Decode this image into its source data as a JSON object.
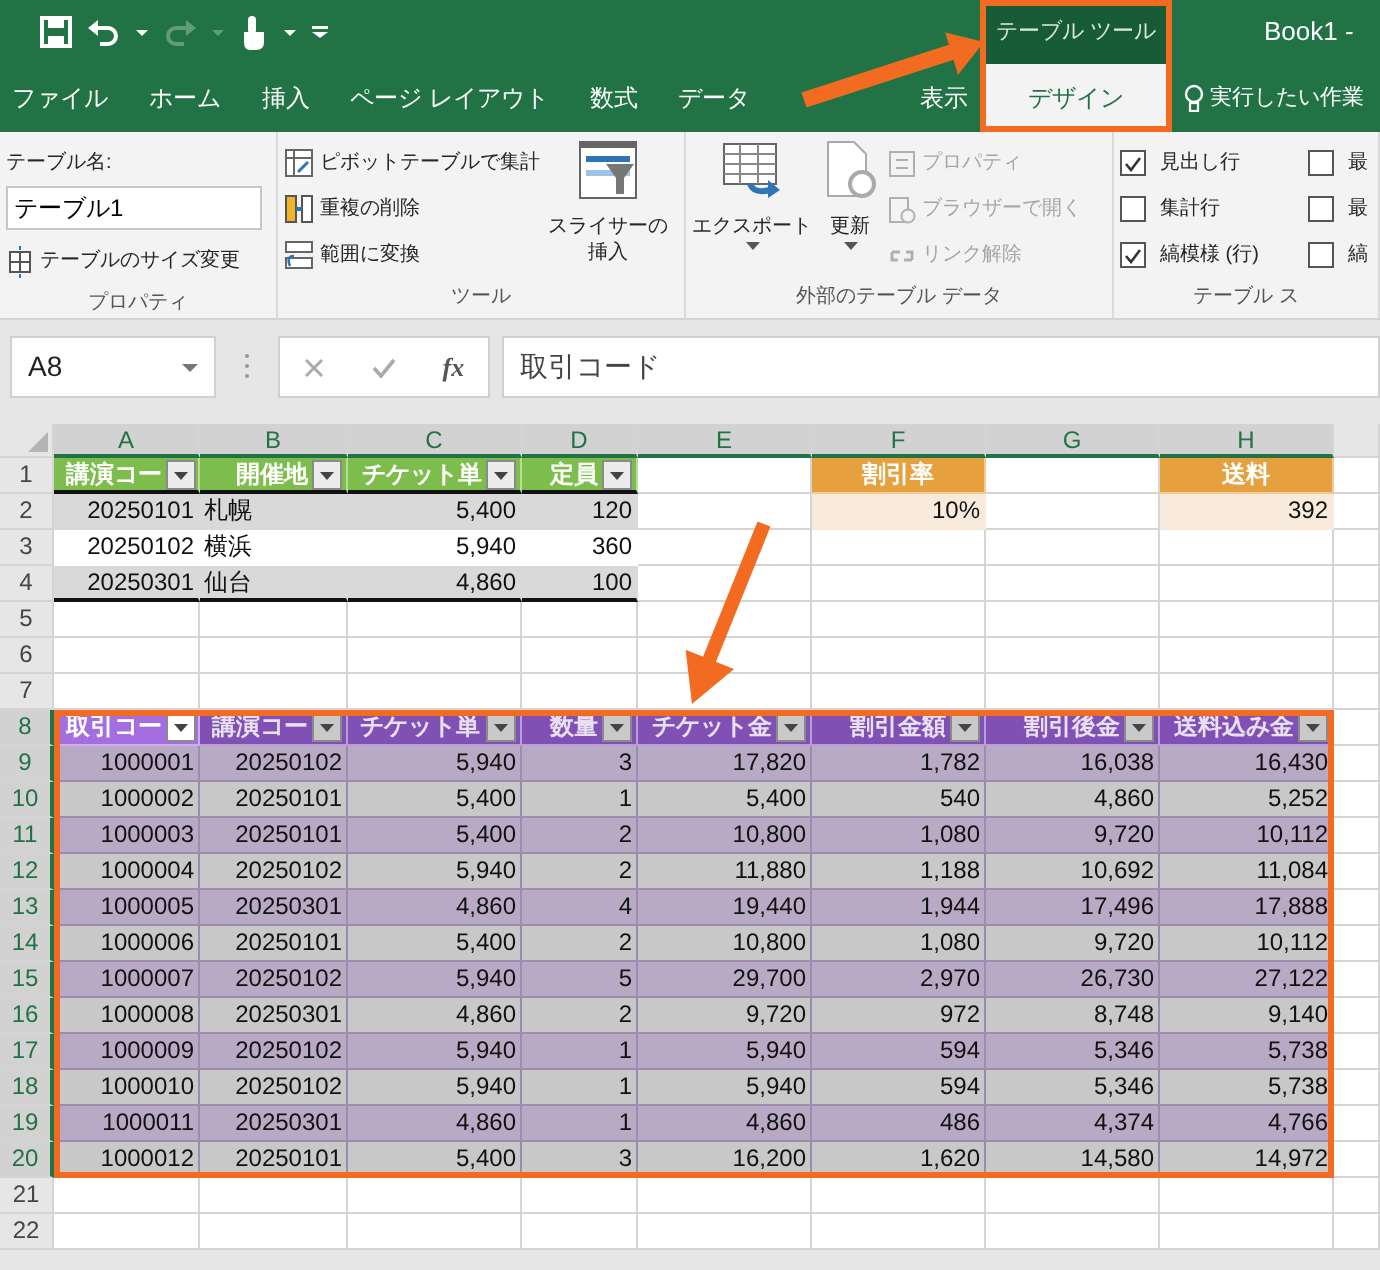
{
  "title_bar": {
    "context_tab": "テーブル ツール",
    "title": "Book1 -"
  },
  "tabs": [
    {
      "label": "ファイル",
      "selected": false
    },
    {
      "label": "ホーム",
      "selected": false
    },
    {
      "label": "挿入",
      "selected": false
    },
    {
      "label": "ページ レイアウト",
      "selected": false
    },
    {
      "label": "数式",
      "selected": false
    },
    {
      "label": "データ",
      "selected": false
    },
    {
      "label": "表示",
      "selected": false
    },
    {
      "label": "デザイン",
      "selected": true
    }
  ],
  "tell_me": "実行したい作業",
  "ribbon": {
    "groups": [
      {
        "kind": "properties",
        "label": "プロパティ",
        "name_label": "テーブル名:",
        "name_value": "テーブル1",
        "resize": "テーブルのサイズ変更"
      },
      {
        "kind": "tools",
        "label": "ツール",
        "buttons": [
          "ピボットテーブルで集計",
          "重複の削除",
          "範囲に変換"
        ],
        "slicer": [
          "スライサーの",
          "挿入"
        ]
      },
      {
        "kind": "external",
        "label": "外部のテーブル データ",
        "large": [
          "エクスポート",
          "更新"
        ],
        "buttons": [
          {
            "label": "プロパティ",
            "disabled": true
          },
          {
            "label": "ブラウザーで開く",
            "disabled": true
          },
          {
            "label": "リンク解除",
            "disabled": true
          }
        ]
      },
      {
        "kind": "style_options",
        "label": "テーブル ス",
        "options": [
          {
            "label": "見出し行",
            "checked": true
          },
          {
            "label": "最",
            "checked": false
          },
          {
            "label": "集計行",
            "checked": false
          },
          {
            "label": "最",
            "checked": false
          },
          {
            "label": "縞模様 (行)",
            "checked": true
          },
          {
            "label": "縞",
            "checked": false
          }
        ]
      }
    ]
  },
  "formula_bar": {
    "name_box": "A8",
    "function_button": "fx",
    "formula": "取引コード"
  },
  "sheet": {
    "columns": [
      {
        "label": "A",
        "selected": true
      },
      {
        "label": "B",
        "selected": true
      },
      {
        "label": "C",
        "selected": true
      },
      {
        "label": "D",
        "selected": true
      },
      {
        "label": "E",
        "selected": true
      },
      {
        "label": "F",
        "selected": true
      },
      {
        "label": "G",
        "selected": true
      },
      {
        "label": "H",
        "selected": true
      }
    ],
    "rows": [
      {
        "number": "1",
        "selected": false,
        "cells": [
          {
            "text": "講演コー",
            "kind": "green_header_cut",
            "filter": true
          },
          {
            "text": "開催地",
            "kind": "green_header",
            "filter": true
          },
          {
            "text": "チケット単",
            "kind": "green_header",
            "filter": true
          },
          {
            "text": "定員",
            "kind": "green_header",
            "filter": true
          },
          {
            "kind": "empty"
          },
          {
            "text": "割引率",
            "kind": "orange_header"
          },
          {
            "kind": "empty"
          },
          {
            "text": "送料",
            "kind": "orange_header"
          }
        ]
      },
      {
        "number": "2",
        "selected": false,
        "kind": "grey_band",
        "cells": [
          "20250101",
          {
            "text": "札幌",
            "kind": "text"
          },
          "5,400",
          "120",
          {
            "kind": "empty"
          },
          {
            "text": "10%",
            "kind": "orange_value"
          },
          {
            "kind": "empty"
          },
          {
            "text": "392",
            "kind": "orange_value"
          }
        ]
      },
      {
        "number": "3",
        "selected": false,
        "kind": "white_band",
        "cells": [
          "20250102",
          {
            "text": "横浜",
            "kind": "text"
          },
          "5,940",
          "360"
        ]
      },
      {
        "number": "4",
        "selected": false,
        "kind": "grey_band",
        "rule": true,
        "cells": [
          "20250301",
          {
            "text": "仙台",
            "kind": "text"
          },
          "4,860",
          "100"
        ]
      },
      {
        "number": "5",
        "selected": false
      },
      {
        "number": "6",
        "selected": false
      },
      {
        "number": "7",
        "selected": false
      },
      {
        "number": "8",
        "selected": true,
        "cells": [
          {
            "text": "取引コー",
            "kind": "purple_active_cut",
            "filter": true
          },
          {
            "text": "講演コー",
            "kind": "purple_header_cut",
            "filter": true
          },
          {
            "text": "チケット単",
            "kind": "purple_header_cut",
            "filter": true
          },
          {
            "text": "数量",
            "kind": "purple_header",
            "filter": true
          },
          {
            "text": "チケット金",
            "kind": "purple_header",
            "filter": true
          },
          {
            "text": "割引金額",
            "kind": "purple_header",
            "filter": true
          },
          {
            "text": "割引後金",
            "kind": "purple_header",
            "filter": true
          },
          {
            "text": "送料込み金",
            "kind": "purple_header",
            "filter": true
          }
        ]
      },
      {
        "number": "9",
        "selected": true,
        "kind": "purple_band",
        "cells": [
          "1000001",
          "20250102",
          "5,940",
          "3",
          "17,820",
          "1,782",
          "16,038",
          "16,430"
        ]
      },
      {
        "number": "10",
        "selected": true,
        "kind": "grey_selected",
        "cells": [
          "1000002",
          "20250101",
          "5,400",
          "1",
          "5,400",
          "540",
          "4,860",
          "5,252"
        ]
      },
      {
        "number": "11",
        "selected": true,
        "kind": "purple_band",
        "cells": [
          "1000003",
          "20250101",
          "5,400",
          "2",
          "10,800",
          "1,080",
          "9,720",
          "10,112"
        ]
      },
      {
        "number": "12",
        "selected": true,
        "kind": "grey_selected",
        "cells": [
          "1000004",
          "20250102",
          "5,940",
          "2",
          "11,880",
          "1,188",
          "10,692",
          "11,084"
        ]
      },
      {
        "number": "13",
        "selected": true,
        "kind": "purple_band",
        "cells": [
          "1000005",
          "20250301",
          "4,860",
          "4",
          "19,440",
          "1,944",
          "17,496",
          "17,888"
        ]
      },
      {
        "number": "14",
        "selected": true,
        "kind": "grey_selected",
        "cells": [
          "1000006",
          "20250101",
          "5,400",
          "2",
          "10,800",
          "1,080",
          "9,720",
          "10,112"
        ]
      },
      {
        "number": "15",
        "selected": true,
        "kind": "purple_band",
        "cells": [
          "1000007",
          "20250102",
          "5,940",
          "5",
          "29,700",
          "2,970",
          "26,730",
          "27,122"
        ]
      },
      {
        "number": "16",
        "selected": true,
        "kind": "grey_selected",
        "cells": [
          "1000008",
          "20250301",
          "4,860",
          "2",
          "9,720",
          "972",
          "8,748",
          "9,140"
        ]
      },
      {
        "number": "17",
        "selected": true,
        "kind": "purple_band",
        "cells": [
          "1000009",
          "20250102",
          "5,940",
          "1",
          "5,940",
          "594",
          "5,346",
          "5,738"
        ]
      },
      {
        "number": "18",
        "selected": true,
        "kind": "grey_selected",
        "cells": [
          "1000010",
          "20250102",
          "5,940",
          "1",
          "5,940",
          "594",
          "5,346",
          "5,738"
        ]
      },
      {
        "number": "19",
        "selected": true,
        "kind": "purple_band",
        "cells": [
          "1000011",
          "20250301",
          "4,860",
          "1",
          "4,860",
          "486",
          "4,374",
          "4,766"
        ]
      },
      {
        "number": "20",
        "selected": true,
        "kind": "grey_selected",
        "cells": [
          "1000012",
          "20250101",
          "5,400",
          "3",
          "16,200",
          "1,620",
          "14,580",
          "14,972"
        ]
      },
      {
        "number": "21",
        "selected": false
      },
      {
        "number": "22",
        "selected": false
      }
    ]
  }
}
